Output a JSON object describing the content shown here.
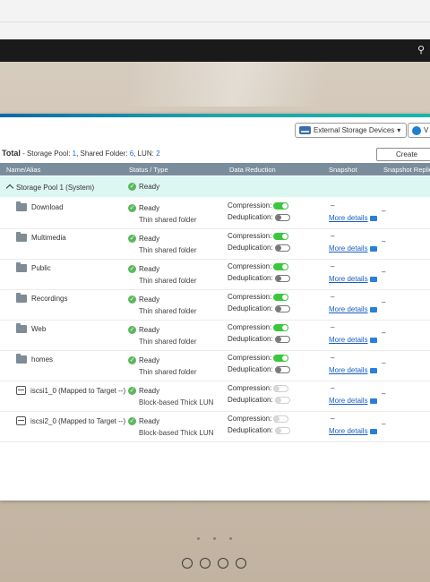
{
  "header": {
    "search_icon": "search-icon"
  },
  "toolbar": {
    "external_storage_label": "External Storage Devices",
    "v_label": "V",
    "create_label": "Create"
  },
  "summary": {
    "total_label": "Total",
    "separator": " - ",
    "storage_pool_label": "Storage Pool: ",
    "storage_pool_count": "1",
    "shared_folder_label": ", Shared Folder: ",
    "shared_folder_count": "6",
    "lun_label": ", LUN: ",
    "lun_count": "2"
  },
  "table": {
    "columns": [
      "Name/Alias",
      "Status / Type",
      "Data Reduction",
      "Snapshot",
      "Snapshot Replic"
    ],
    "pool": {
      "name": "Storage Pool 1 (System)",
      "status": "Ready"
    },
    "labels": {
      "compression": "Compression:",
      "deduplication": "Deduplication:",
      "more_details": "More details",
      "dash": "–"
    },
    "rows": [
      {
        "name": "Download",
        "status": "Ready",
        "type": "Thin shared folder",
        "icon": "folder-icon",
        "compression": "on",
        "dedup": "off"
      },
      {
        "name": "Multimedia",
        "status": "Ready",
        "type": "Thin shared folder",
        "icon": "folder-icon",
        "compression": "on",
        "dedup": "off"
      },
      {
        "name": "Public",
        "status": "Ready",
        "type": "Thin shared folder",
        "icon": "folder-icon",
        "compression": "on",
        "dedup": "off"
      },
      {
        "name": "Recordings",
        "status": "Ready",
        "type": "Thin shared folder",
        "icon": "folder-icon",
        "compression": "on",
        "dedup": "off"
      },
      {
        "name": "Web",
        "status": "Ready",
        "type": "Thin shared folder",
        "icon": "folder-icon",
        "compression": "on",
        "dedup": "off"
      },
      {
        "name": "homes",
        "status": "Ready",
        "type": "Thin shared folder",
        "icon": "folder-icon",
        "compression": "on",
        "dedup": "off"
      },
      {
        "name": "iscsi1_0 (Mapped to Target --)",
        "status": "Ready",
        "type": "Block-based Thick LUN",
        "icon": "lun-icon",
        "compression": "disabled",
        "dedup": "disabled"
      },
      {
        "name": "iscsi2_0 (Mapped to Target --)",
        "status": "Ready",
        "type": "Block-based Thick LUN",
        "icon": "lun-icon",
        "compression": "disabled",
        "dedup": "disabled"
      }
    ]
  },
  "colors": {
    "accent": "#16b6a7",
    "header_row": "#7a8d9c",
    "pool_row": "#dcf7f1",
    "ready": "#5cb85c",
    "toggle_on": "#3cc63c",
    "link": "#1a5fbf"
  }
}
